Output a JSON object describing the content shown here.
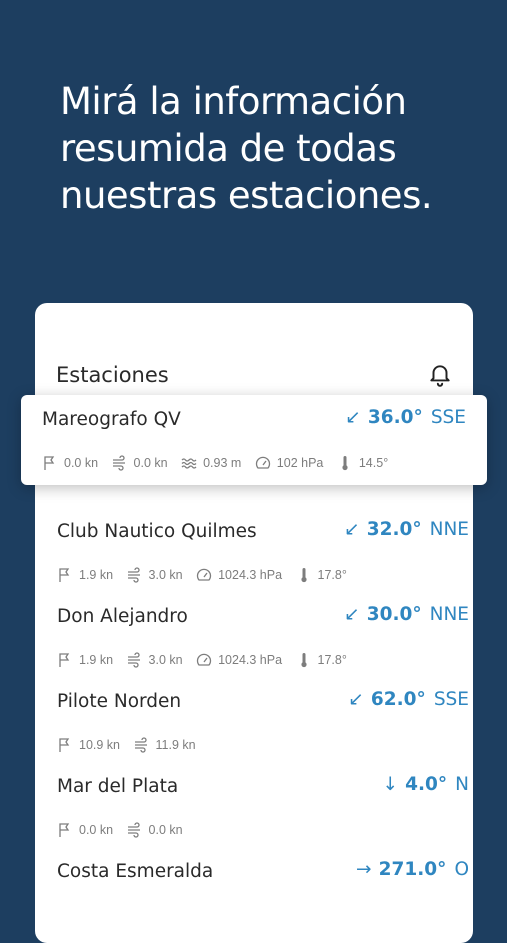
{
  "headline": "Mirá la información resumida de todas nuestras estaciones.",
  "card": {
    "title": "Estaciones"
  },
  "stations": [
    {
      "name": "Mareografo QV",
      "arrow": "↙",
      "degrees": "36.0°",
      "dir": "SSE",
      "wind": "0.0 kn",
      "gust": "0.0 kn",
      "wave": "0.93 m",
      "pressure": "102 hPa",
      "temp": "14.5°"
    },
    {
      "name": "Club Nautico Quilmes",
      "arrow": "↙",
      "degrees": "32.0°",
      "dir": "NNE",
      "wind": "1.9 kn",
      "gust": "3.0 kn",
      "pressure": "1024.3 hPa",
      "temp": "17.8°"
    },
    {
      "name": "Don Alejandro",
      "arrow": "↙",
      "degrees": "30.0°",
      "dir": "NNE",
      "wind": "1.9 kn",
      "gust": "3.0 kn",
      "pressure": "1024.3 hPa",
      "temp": "17.8°"
    },
    {
      "name": "Pilote Norden",
      "arrow": "↙",
      "degrees": "62.0°",
      "dir": "SSE",
      "wind": "10.9 kn",
      "gust": "11.9 kn"
    },
    {
      "name": "Mar del Plata",
      "arrow": "↓",
      "degrees": "4.0°",
      "dir": "N",
      "wind": "0.0 kn",
      "gust": "0.0 kn"
    },
    {
      "name": "Costa Esmeralda",
      "arrow": "→",
      "degrees": "271.0°",
      "dir": "O"
    }
  ]
}
